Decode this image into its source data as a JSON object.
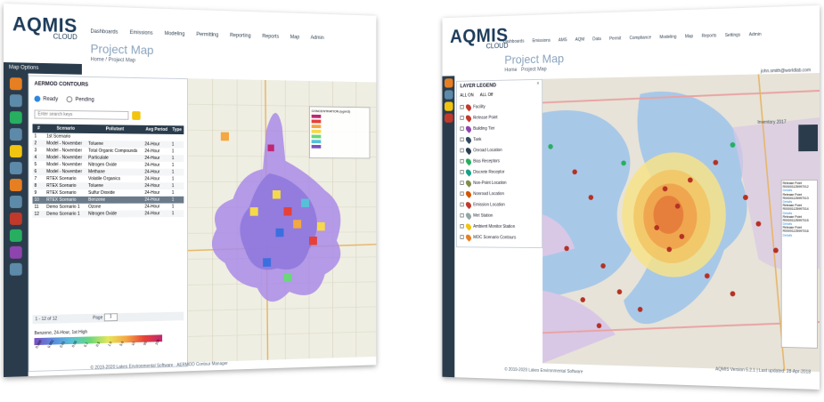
{
  "left": {
    "brand_main": "AQMIS",
    "brand_sub": "CLOUD",
    "nav": [
      "Dashboards",
      "Emissions",
      "Modeling",
      "Permitting",
      "Reporting",
      "Reports",
      "Map",
      "Admin"
    ],
    "page_title": "Project Map",
    "breadcrumb": "Home / Project Map",
    "map_options_label": "Map Options",
    "panel_title": "AERMOD CONTOURS",
    "status_ready": "Ready",
    "status_pending": "Pending",
    "search_placeholder": "Enter search keys",
    "table_headers": [
      "#",
      "Scenario",
      "Pollutant",
      "Avg Period",
      "Type"
    ],
    "rows": [
      {
        "n": "1",
        "scenario": "1st Scenario",
        "pollutant": "",
        "avg": "",
        "type": ""
      },
      {
        "n": "2",
        "scenario": "Model - November",
        "pollutant": "Toluene",
        "avg": "24-Hour",
        "type": "1"
      },
      {
        "n": "3",
        "scenario": "Model - November",
        "pollutant": "Total Organic Compounds",
        "avg": "24-Hour",
        "type": "1"
      },
      {
        "n": "4",
        "scenario": "Model - November",
        "pollutant": "Particulate",
        "avg": "24-Hour",
        "type": "1"
      },
      {
        "n": "5",
        "scenario": "Model - November",
        "pollutant": "Nitrogen Oxide",
        "avg": "24-Hour",
        "type": "1"
      },
      {
        "n": "6",
        "scenario": "Model - November",
        "pollutant": "Methane",
        "avg": "24-Hour",
        "type": "1"
      },
      {
        "n": "7",
        "scenario": "RTEX Scenario",
        "pollutant": "Volatile Organics",
        "avg": "24-Hour",
        "type": "1"
      },
      {
        "n": "8",
        "scenario": "RTEX Scenario",
        "pollutant": "Toluene",
        "avg": "24-Hour",
        "type": "1"
      },
      {
        "n": "9",
        "scenario": "RTEX Scenario",
        "pollutant": "Sulfur Dioxide",
        "avg": "24-Hour",
        "type": "1"
      },
      {
        "n": "10",
        "scenario": "RTEX Scenario",
        "pollutant": "Benzene",
        "avg": "24-Hour",
        "type": "1"
      },
      {
        "n": "11",
        "scenario": "Demo Scenario 1",
        "pollutant": "Ozone",
        "avg": "24-Hour",
        "type": "1"
      },
      {
        "n": "12",
        "scenario": "Demo Scenario 1",
        "pollutant": "Nitrogen Oxide",
        "avg": "24-Hour",
        "type": "1"
      }
    ],
    "pager": "1 - 12 of 12",
    "page_label": "Page",
    "page_value": "1",
    "legend_title": "Benzene, 24-Hour, 1st High",
    "legend_values": [
      "0.000",
      "0.001",
      "0.01",
      "0.05",
      "0.1",
      "0.5",
      "1.0",
      "5.0",
      "10",
      "50",
      "100"
    ],
    "footer": "© 2019-2020 Lakes Environmental Software · AERMOD Contour Manager",
    "zoom_label": "Zoom",
    "map_legend_title": "CONCENTRATION (ug/m3)"
  },
  "right": {
    "brand_main": "AQMIS",
    "brand_sub": "CLOUD",
    "nav": [
      "Dashboards",
      "Emissions",
      "AMS",
      "AQM",
      "Data",
      "Permit",
      "Compliance",
      "Modeling",
      "Map",
      "Reports",
      "Settings",
      "Admin"
    ],
    "page_title": "Project Map",
    "breadcrumb_home": "Home",
    "breadcrumb_page": "Project Map",
    "user": "john.smith@worldlab.com",
    "legend_title": "LAYER LEGEND",
    "all_on": "ALL ON",
    "all_off": "ALL Off",
    "layers": [
      {
        "label": "Facility",
        "color": "#c0392b"
      },
      {
        "label": "Release Point",
        "color": "#c0392b"
      },
      {
        "label": "Building Tier",
        "color": "#8e44ad"
      },
      {
        "label": "Tank",
        "color": "#34495e"
      },
      {
        "label": "Onroad Location",
        "color": "#2c3e50"
      },
      {
        "label": "Bias Receptors",
        "color": "#27ae60"
      },
      {
        "label": "Discrete Receptor",
        "color": "#16a085"
      },
      {
        "label": "Non-Point Location",
        "color": "#7f8c4a"
      },
      {
        "label": "Nonroad Location",
        "color": "#d35400"
      },
      {
        "label": "Emission Location",
        "color": "#c0392b"
      },
      {
        "label": "Met Station",
        "color": "#95a5a6"
      },
      {
        "label": "Ambient Monitor Station",
        "color": "#f1c40f"
      },
      {
        "label": "MOC Scenario Contours",
        "color": "#e67e22"
      }
    ],
    "info_lines": [
      "Release Point",
      "R00001125997012",
      "Details",
      "Release Point",
      "R00001125997013",
      "Details",
      "Release Point",
      "R00001125997014",
      "Details",
      "Release Point",
      "R00001125997015",
      "Details",
      "Release Point",
      "R00001125997016",
      "Details"
    ],
    "date_label": "Inventory 2017",
    "footer": "© 2019-2020 Lakes Environmental Software",
    "version": "AQMIS Version 5.2.1 | Last updated: 28-Apr-2018"
  }
}
